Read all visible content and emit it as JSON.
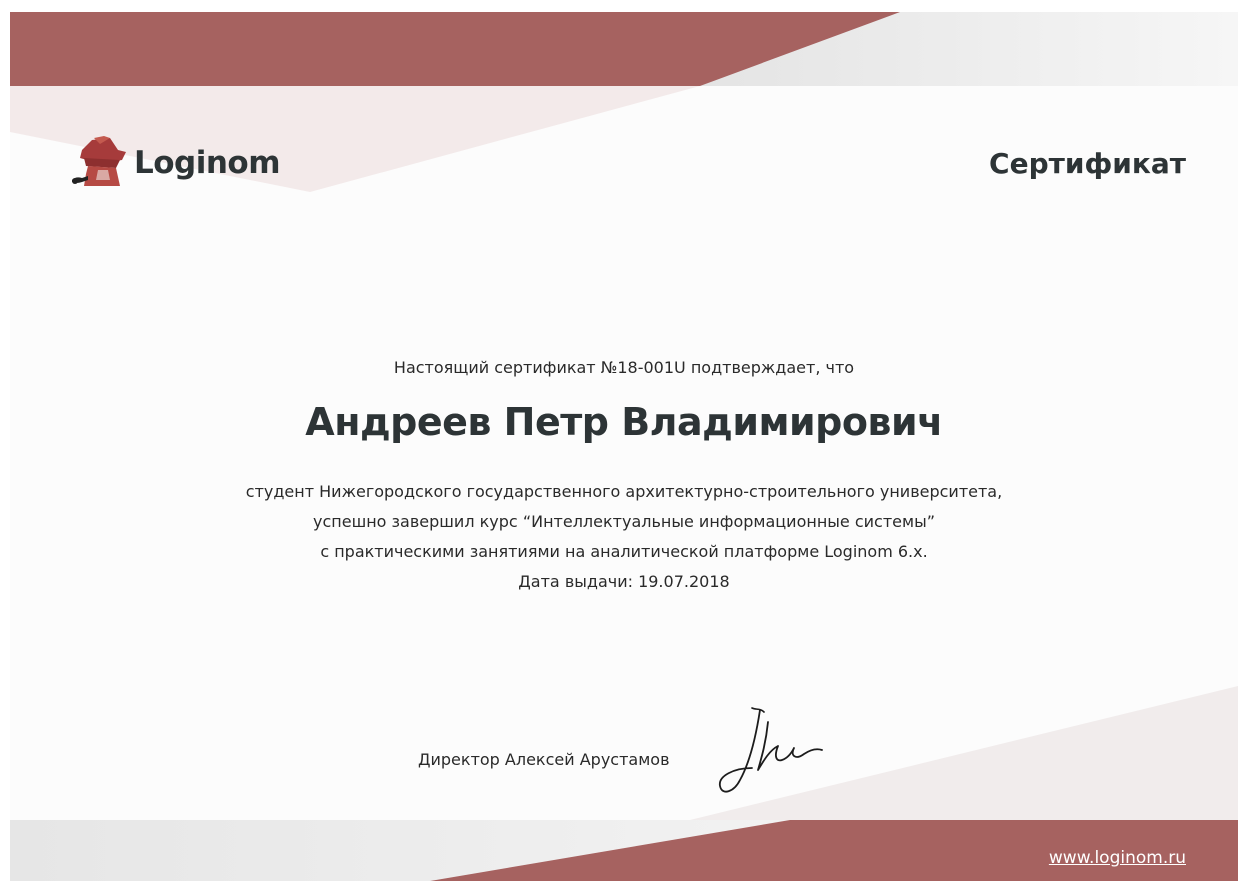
{
  "header": {
    "logo_text": "Loginom",
    "logo_icon": "detective-hat-icon",
    "title": "Сертификат"
  },
  "certificate": {
    "intro": "Настоящий сертификат №18-001U подтверждает, что",
    "recipient_name": "Андреев Петр Владимирович",
    "lines": [
      "студент Нижегородского государственного архитектурно-строительного университета,",
      "успешно завершил курс “Интеллектуальные информационные системы”",
      "с практическими занятиями на аналитической платформе Loginom 6.x.",
      "Дата выдачи: 19.07.2018"
    ]
  },
  "footer": {
    "director": "Директор Алексей Арустамов",
    "signature": "handwritten-signature",
    "website": "www.loginom.ru"
  },
  "colors": {
    "accent": "#a66260",
    "accent_light": "#f3eaea",
    "text_dark": "#2d3436"
  }
}
